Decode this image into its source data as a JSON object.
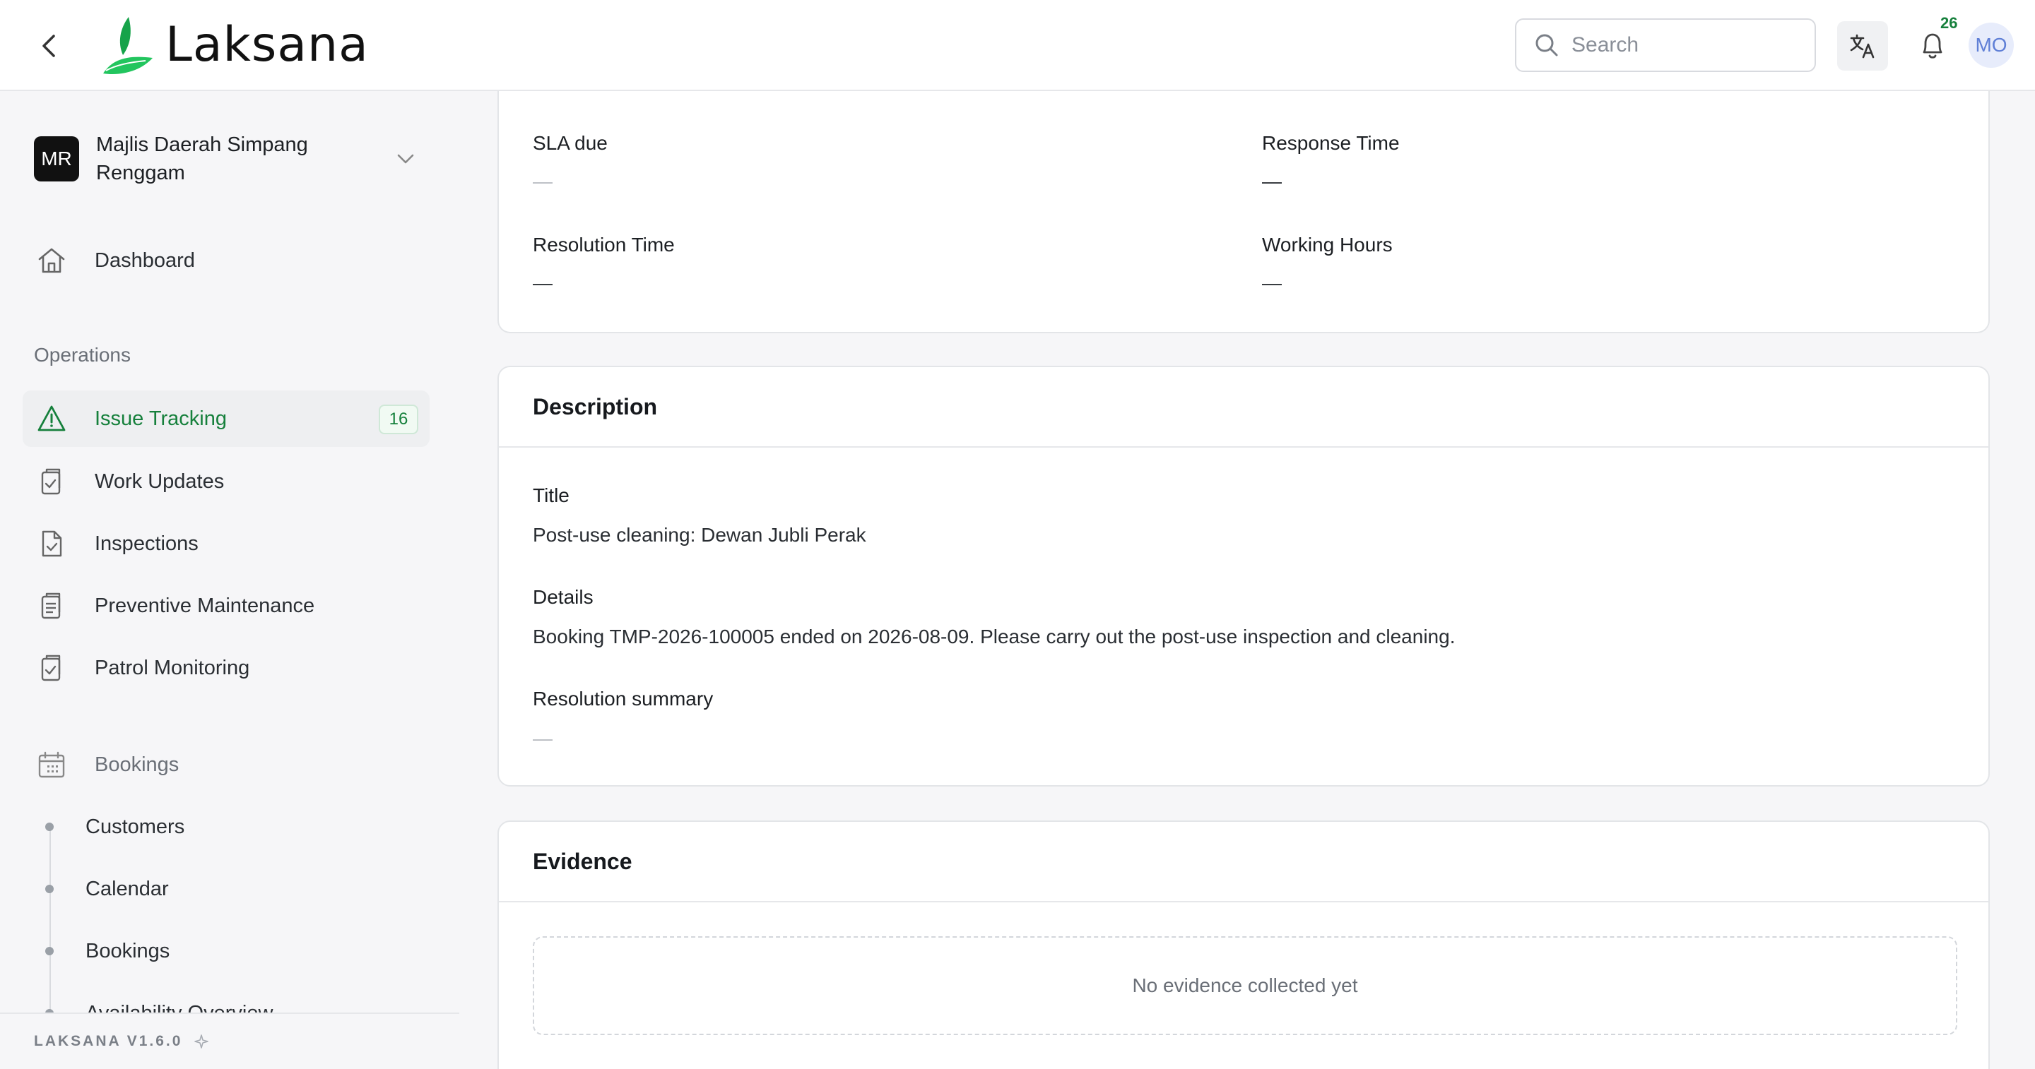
{
  "header": {
    "app_name": "Laksana",
    "search_placeholder": "Search",
    "notification_count": "26",
    "user_initials": "MO",
    "brand_color": "#16a34a"
  },
  "sidebar": {
    "org_initials": "MR",
    "org_name": "Majlis Daerah Simpang Renggam",
    "dashboard": "Dashboard",
    "operations_label": "Operations",
    "items": [
      {
        "label": "Issue Tracking",
        "badge": "16",
        "icon": "alert-triangle-icon"
      },
      {
        "label": "Work Updates",
        "icon": "clipboard-check-icon"
      },
      {
        "label": "Inspections",
        "icon": "file-check-icon"
      },
      {
        "label": "Preventive Maintenance",
        "icon": "clipboard-list-icon"
      },
      {
        "label": "Patrol Monitoring",
        "icon": "clipboard-check-icon"
      }
    ],
    "bookings_label": "Bookings",
    "bookings_items": [
      "Customers",
      "Calendar",
      "Bookings",
      "Availability Overview"
    ],
    "version": "LAKSANA V1.6.0"
  },
  "sla": {
    "sla_due_label": "SLA due",
    "sla_due_value": "—",
    "response_time_label": "Response Time",
    "response_time_value": "—",
    "resolution_time_label": "Resolution Time",
    "resolution_time_value": "—",
    "working_hours_label": "Working Hours",
    "working_hours_value": "—"
  },
  "description": {
    "heading": "Description",
    "title_label": "Title",
    "title_value": "Post-use cleaning: Dewan Jubli Perak",
    "details_label": "Details",
    "details_value": "Booking TMP-2026-100005 ended on 2026-08-09. Please carry out the post-use inspection and cleaning.",
    "resolution_label": "Resolution summary",
    "resolution_value": "—"
  },
  "evidence": {
    "heading": "Evidence",
    "empty_text": "No evidence collected yet"
  }
}
